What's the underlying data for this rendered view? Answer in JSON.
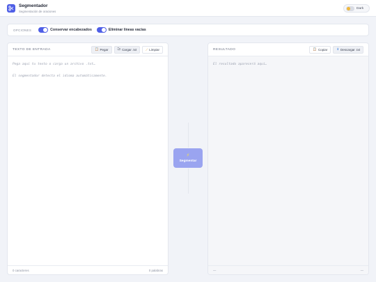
{
  "header": {
    "title": "Segmentador",
    "subtitle": "Segmentación de oraciones",
    "theme_label": "Dark"
  },
  "options": {
    "label": "OPCIONES",
    "items": [
      {
        "label": "Conservar encabezados",
        "enabled": true
      },
      {
        "label": "Eliminar líneas vacías",
        "enabled": true
      }
    ]
  },
  "input_panel": {
    "title": "TEXTO DE ENTRADA",
    "paste_label": "Pegar",
    "upload_label": "Cargar .txt",
    "clear_label": "Limpiar",
    "placeholder": "Pega aquí tu texto o carga un archivo .txt…\n\nEl segmentador detecta el idioma automáticamente.",
    "char_count": "0 caracteres",
    "word_count": "0 palabras"
  },
  "action": {
    "segment_label": "Segmentar"
  },
  "output_panel": {
    "title": "RESULTADO",
    "copy_label": "Copiar",
    "download_label": "Descargar .txt",
    "placeholder": "El resultado aparecerá aquí…",
    "footer_left": "—",
    "footer_right": "—"
  },
  "colors": {
    "accent": "#4f5fe6",
    "segment_button": "#9aa4f0",
    "background": "#f1f3f8"
  },
  "icons": {
    "logo": "scissors-icon",
    "theme": "sun-icon",
    "paste": "clipboard-icon",
    "upload": "folder-icon",
    "clear": "broom-icon",
    "copy": "clipboard-icon",
    "download": "download-icon",
    "segment": "lightning-icon"
  }
}
